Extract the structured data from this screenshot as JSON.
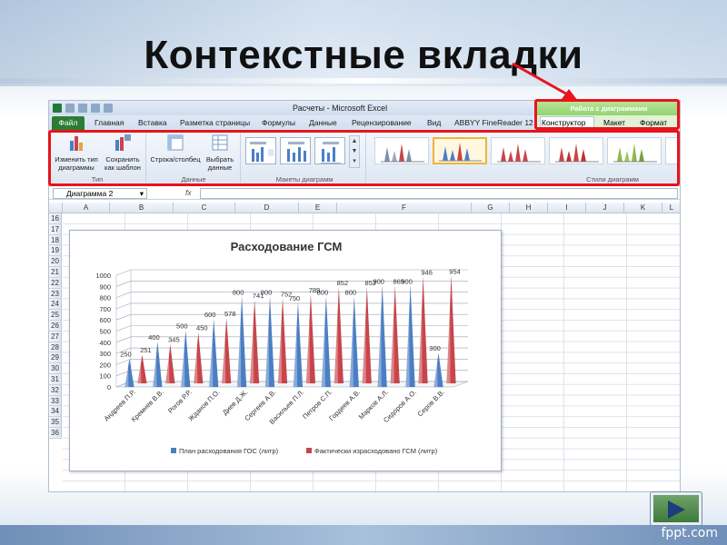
{
  "slide": {
    "title": "Контекстные вкладки",
    "watermark": "fppt.com",
    "next_icon": "play-triangle-icon"
  },
  "excel": {
    "window_title": "Расчеты  -  Microsoft Excel",
    "contextual_group": "Работа с диаграммами",
    "tabs": [
      {
        "label": "Файл"
      },
      {
        "label": "Главная"
      },
      {
        "label": "Вставка"
      },
      {
        "label": "Разметка страницы"
      },
      {
        "label": "Формулы"
      },
      {
        "label": "Данные"
      },
      {
        "label": "Рецензирование"
      },
      {
        "label": "Вид"
      },
      {
        "label": "ABBYY FineReader 12"
      },
      {
        "label": "Конструктор"
      },
      {
        "label": "Макет"
      },
      {
        "label": "Формат"
      }
    ],
    "ribbon": {
      "change_type": "Изменить тип диаграммы",
      "save_template": "Сохранить как шаблон",
      "group_type": "Тип",
      "switch_row_col": "Строка/столбец",
      "select_data": "Выбрать данные",
      "group_data": "Данные",
      "group_layouts": "Макеты диаграмм",
      "group_styles": "Стили диаграмм"
    },
    "formula_bar": {
      "name_box": "Диаграмма 2",
      "fx": "fx"
    },
    "columns": [
      "A",
      "B",
      "C",
      "D",
      "E",
      "F",
      "G",
      "H",
      "I",
      "J",
      "K",
      "L"
    ],
    "rows": [
      "16",
      "17",
      "18",
      "19",
      "20",
      "21",
      "22",
      "23",
      "24",
      "25",
      "26",
      "27",
      "28",
      "29",
      "30",
      "31",
      "32",
      "33",
      "34",
      "35",
      "36"
    ]
  },
  "chart_data": {
    "type": "bar",
    "title": "Расходование ГСМ",
    "categories": [
      "Андреев П.Р.",
      "Кремнев В.В.",
      "Рогов Р.Р.",
      "Жданов П.О.",
      "Диев Д.Ж.",
      "Сергеев А.В.",
      "Васильев П.Л.",
      "Петров С.П.",
      "Гордеев А.В.",
      "Марков А.Л.",
      "Сидоров А.О.",
      "Серов В.В."
    ],
    "series": [
      {
        "name": "План расходования ГОС (литр)",
        "color": "#4a7fc6",
        "values": [
          250,
          400,
          500,
          600,
          800,
          800,
          750,
          800,
          800,
          900,
          900,
          300
        ]
      },
      {
        "name": "Фактически израсходовано ГСМ (литр)",
        "color": "#c9454a",
        "values": [
          251,
          345,
          450,
          578,
          741,
          752,
          789,
          852,
          852,
          865,
          946,
          954
        ]
      }
    ],
    "ylim": [
      0,
      1000
    ],
    "yticks": [
      0,
      100,
      200,
      300,
      400,
      500,
      600,
      700,
      800,
      900,
      1000
    ],
    "legend": "bottom",
    "grid": true
  }
}
